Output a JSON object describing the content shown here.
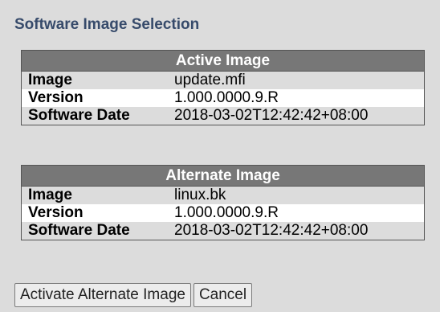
{
  "page": {
    "title": "Software Image Selection"
  },
  "active_image": {
    "header": "Active Image",
    "rows": [
      {
        "label": "Image",
        "value": "update.mfi"
      },
      {
        "label": "Version",
        "value": "1.000.0000.9.R"
      },
      {
        "label": "Software Date",
        "value": "2018-03-02T12:42:42+08:00"
      }
    ]
  },
  "alternate_image": {
    "header": "Alternate Image",
    "rows": [
      {
        "label": "Image",
        "value": "linux.bk"
      },
      {
        "label": "Version",
        "value": "1.000.0000.9.R"
      },
      {
        "label": "Software Date",
        "value": "2018-03-02T12:42:42+08:00"
      }
    ]
  },
  "buttons": {
    "activate_label": "Activate Alternate Image",
    "cancel_label": "Cancel"
  },
  "colors": {
    "background": "#dcdcdc",
    "header_bg": "#777777",
    "heading_text": "#374b6b"
  }
}
